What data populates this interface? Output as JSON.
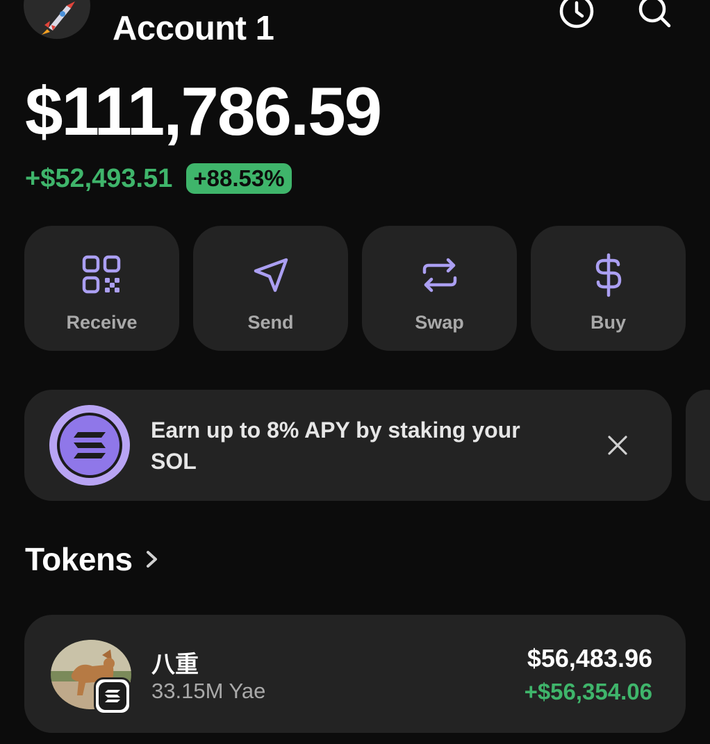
{
  "header": {
    "account_name": "Account 1",
    "avatar_icon": "rocket-icon",
    "history_icon": "clock-icon",
    "search_icon": "search-icon"
  },
  "balance": {
    "total": "$111,786.59",
    "change_amount": "+$52,493.51",
    "change_percent": "+88.53%"
  },
  "actions": [
    {
      "label": "Receive",
      "icon": "qr-code-icon"
    },
    {
      "label": "Send",
      "icon": "send-icon"
    },
    {
      "label": "Swap",
      "icon": "swap-icon"
    },
    {
      "label": "Buy",
      "icon": "dollar-icon"
    }
  ],
  "banner": {
    "text": "Earn up to 8% APY by staking your SOL",
    "icon": "solana-icon",
    "close_icon": "close-icon"
  },
  "tokens": {
    "title": "Tokens",
    "items": [
      {
        "name": "八重",
        "amount": "33.15M Yae",
        "value": "$56,483.96",
        "change": "+$56,354.06"
      }
    ]
  },
  "colors": {
    "background": "#0c0c0c",
    "card": "#232323",
    "accent": "#ab9ff2",
    "positive": "#3fb56b",
    "muted_text": "#a9a9a9"
  }
}
